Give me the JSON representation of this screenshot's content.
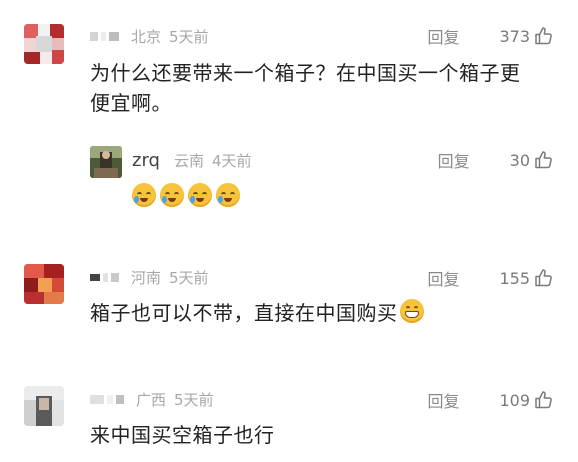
{
  "comments": [
    {
      "location": "北京",
      "time": "5天前",
      "reply_label": "回复",
      "likes": "373",
      "text_line1": "为什么还要带来一个箱子？在中国买一个箱子更",
      "text_line2": "便宜啊。",
      "reply": {
        "username": "zrq",
        "location": "云南",
        "time": "4天前",
        "reply_label": "回复",
        "likes": "30",
        "emoji_name": "crying-laughing-emoji"
      }
    },
    {
      "location": "河南",
      "time": "5天前",
      "reply_label": "回复",
      "likes": "155",
      "text": "箱子也可以不带，直接在中国购买",
      "emoji_name": "grinning-emoji"
    },
    {
      "location": "广西",
      "time": "5天前",
      "reply_label": "回复",
      "likes": "109",
      "text": "来中国买空箱子也行"
    }
  ],
  "colors": {
    "meta_text": "#a8a8a8",
    "body_text": "#222222",
    "action_text": "#8a8a8a"
  }
}
